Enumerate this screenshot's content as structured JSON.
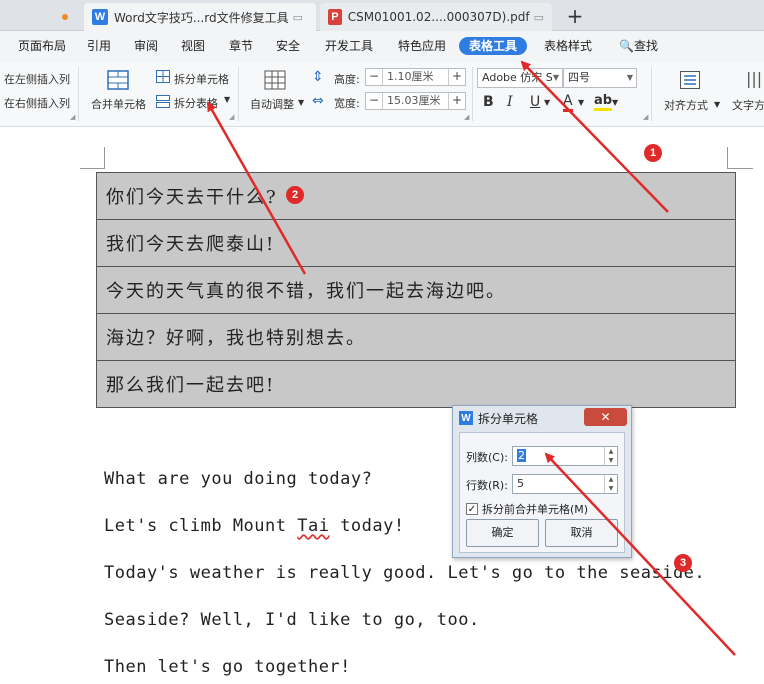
{
  "tabs": [
    {
      "label": "",
      "has_dot": true
    },
    {
      "label": "Word文字技巧...rd文件修复工具",
      "icon": "W",
      "icon_color": "#2f7de1"
    },
    {
      "label": "CSM01001.02....000307D).pdf",
      "icon": "P",
      "icon_color": "#d9413a"
    }
  ],
  "new_tab": "+",
  "menu": {
    "items": [
      "页面布局",
      "引用",
      "审阅",
      "视图",
      "章节",
      "安全",
      "开发工具",
      "特色应用",
      "表格工具",
      "表格样式",
      "查找"
    ],
    "active": "表格工具"
  },
  "toolbar": {
    "insert_left_col": "在左侧插入列",
    "insert_right_col": "在右侧插入列",
    "merge_cells": "合并单元格",
    "split_cells": "拆分单元格",
    "split_table": "拆分表格",
    "auto_adjust": "自动调整",
    "height_label": "高度:",
    "height_value": "1.10厘米",
    "width_label": "宽度:",
    "width_value": "15.03厘米",
    "font_name": "Adobe 仿宋 S",
    "font_size": "四号",
    "bold": "B",
    "italic": "I",
    "underline": "U",
    "font_color": "A",
    "highlight": "ab",
    "align": "对齐方式",
    "text_dir": "文字方"
  },
  "table_rows": [
    "你们今天去干什么?",
    "我们今天去爬泰山!",
    "今天的天气真的很不错，我们一起去海边吧。",
    "海边？好啊，我也特别想去。",
    "那么我们一起去吧!"
  ],
  "english_lines": [
    "What are you doing today?",
    "Let's climb Mount Tai today!",
    "Today's weather is really good. Let's go to the seaside.",
    "Seaside? Well, I'd like to go, too.",
    "Then let's go together!"
  ],
  "dialog": {
    "title": "拆分单元格",
    "cols_label": "列数(C):",
    "cols_value": "2",
    "rows_label": "行数(R):",
    "rows_value": "5",
    "merge_check_label": "拆分前合并单元格(M)",
    "merge_checked": true,
    "ok": "确定",
    "cancel": "取消"
  },
  "annotations": [
    "1",
    "2",
    "3"
  ],
  "colors": {
    "accent": "#2f7de1",
    "annotation_red": "#e02a2a",
    "table_fill": "#c8c8c8"
  }
}
